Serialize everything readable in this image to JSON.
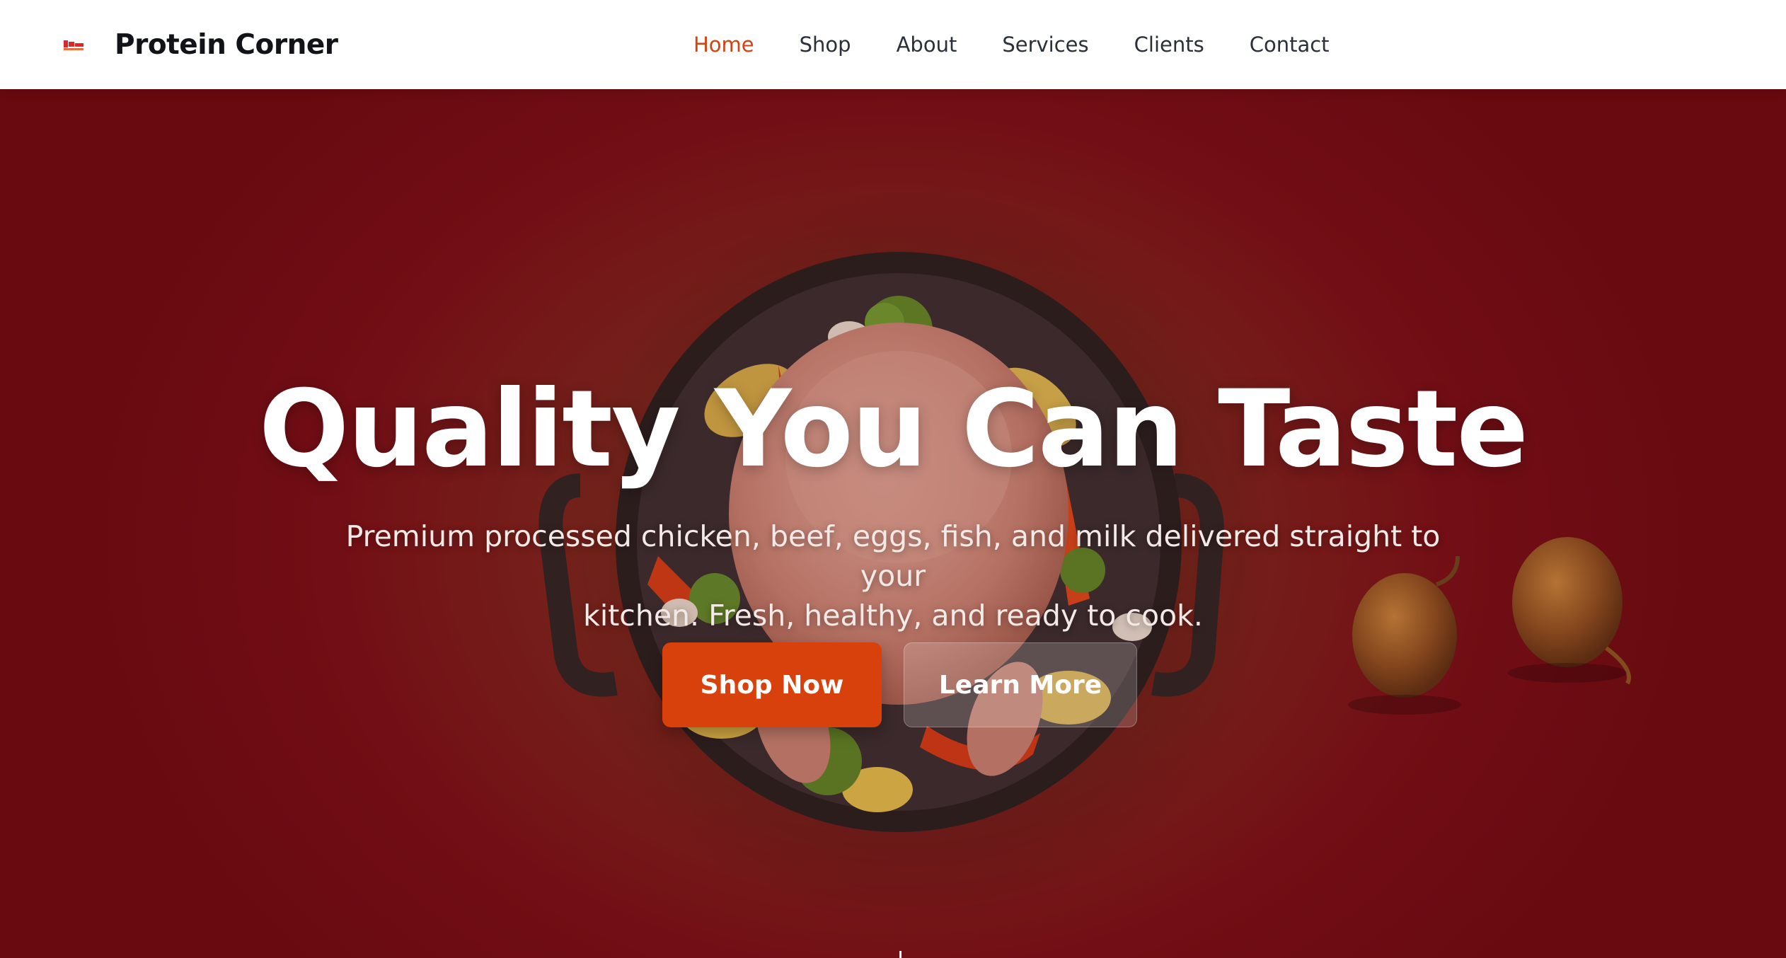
{
  "header": {
    "brand_name": "Protein Corner",
    "logo_icon": "protein-corner-logo-icon",
    "nav": [
      {
        "label": "Home",
        "active": true
      },
      {
        "label": "Shop",
        "active": false
      },
      {
        "label": "About",
        "active": false
      },
      {
        "label": "Services",
        "active": false
      },
      {
        "label": "Clients",
        "active": false
      },
      {
        "label": "Contact",
        "active": false
      }
    ]
  },
  "hero": {
    "title": "Quality You Can Taste",
    "subtitle_line1": "Premium processed chicken, beef, eggs, fish, and milk delivered straight to your",
    "subtitle_line2": "kitchen. Fresh, healthy, and ready to cook.",
    "primary_button": "Shop Now",
    "secondary_button": "Learn More",
    "image": "roast-chicken-pan-with-vegetables-and-onions"
  },
  "colors": {
    "accent": "#d8400c",
    "nav_active": "#d64110",
    "hero_bg": "#7a0d14",
    "brand_text": "#111318"
  }
}
